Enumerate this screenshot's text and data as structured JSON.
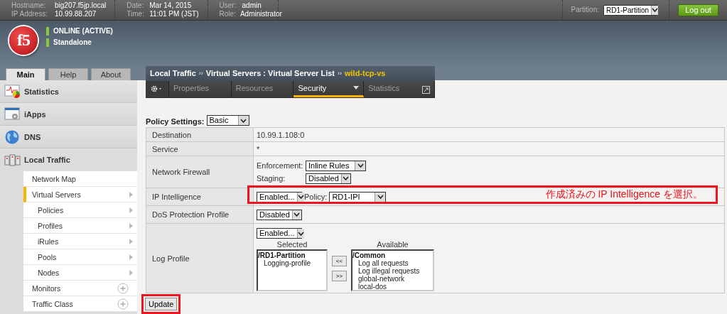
{
  "header": {
    "fields": [
      {
        "label": "Hostname:",
        "value": "big207.f5jp.local"
      },
      {
        "label": "IP Address:",
        "value": "10.99.88.207"
      }
    ],
    "fields2": [
      {
        "label": "Date:",
        "value": "Mar 14, 2015"
      },
      {
        "label": "Time:",
        "value": "11:01 PM (JST)"
      }
    ],
    "fields3": [
      {
        "label": "User:",
        "value": "admin"
      },
      {
        "label": "Role:",
        "value": "Administrator"
      }
    ],
    "partition_label": "Partition:",
    "partition": "RD1-Partition",
    "logout": "Log out"
  },
  "logo": "f5",
  "status": [
    {
      "text": "ONLINE (ACTIVE)",
      "color": "#8dc63f"
    },
    {
      "text": "Standalone",
      "color": "#8dc63f"
    }
  ],
  "nav_tabs": [
    {
      "label": "Main",
      "selected": true
    },
    {
      "label": "Help",
      "selected": false
    },
    {
      "label": "About",
      "selected": false
    }
  ],
  "nav_sections": [
    {
      "label": "Statistics",
      "expanded": false
    },
    {
      "label": "iApps",
      "expanded": false
    },
    {
      "label": "DNS",
      "expanded": false
    },
    {
      "label": "Local Traffic",
      "expanded": true,
      "children": [
        {
          "label": "Network Map",
          "kind": "link",
          "selected": false
        },
        {
          "label": "Virtual Servers",
          "kind": "submenu",
          "selected": true,
          "children": [
            {
              "label": "Policies",
              "kind": "submenu",
              "selected": false
            },
            {
              "label": "Profiles",
              "kind": "submenu",
              "selected": false
            },
            {
              "label": "iRules",
              "kind": "submenu",
              "selected": false
            },
            {
              "label": "Pools",
              "kind": "submenu",
              "selected": false
            },
            {
              "label": "Nodes",
              "kind": "submenu",
              "selected": false
            }
          ]
        },
        {
          "label": "Monitors",
          "kind": "add",
          "selected": false
        },
        {
          "label": "Traffic Class",
          "kind": "add",
          "selected": false
        }
      ]
    }
  ],
  "breadcrumb": [
    {
      "text": "Local Traffic",
      "kind": "crumb"
    },
    {
      "text": "››",
      "kind": "separator"
    },
    {
      "text": "Virtual Servers : Virtual Server List",
      "kind": "crumb"
    },
    {
      "text": "››",
      "kind": "separator"
    },
    {
      "text": "wild-tcp-vs",
      "kind": "current"
    }
  ],
  "tabs": [
    {
      "label": "Properties",
      "kind": "plain",
      "selected": false
    },
    {
      "label": "Resources",
      "kind": "plain",
      "selected": false
    },
    {
      "label": "Security",
      "kind": "menu",
      "selected": true
    },
    {
      "label": "Statistics",
      "kind": "external",
      "selected": false
    }
  ],
  "policy_settings": {
    "label": "Policy Settings:",
    "value": "Basic"
  },
  "rows": [
    {
      "label": "Destination",
      "kind": "text",
      "value": "10.99.1.108:0"
    },
    {
      "label": "Service",
      "kind": "text",
      "value": "*"
    },
    {
      "label": "Network Firewall",
      "kind": "stacked",
      "fields": [
        {
          "label": "Enforcement:",
          "value": "Inline Rules"
        },
        {
          "label": "Staging:",
          "value": "Disabled"
        }
      ]
    },
    {
      "label": "IP Intelligence",
      "kind": "inline",
      "highlighted": true,
      "callout": "作成済みの IP Intelligence を選択。",
      "fields": [
        {
          "value": "Enabled..."
        },
        {
          "label": "Policy:",
          "value": "RD1-IPI"
        }
      ]
    },
    {
      "label": "DoS Protection Profile",
      "kind": "inline",
      "fields": [
        {
          "value": "Disabled"
        }
      ]
    },
    {
      "label": "Log Profile",
      "kind": "log",
      "select": "Enabled...",
      "selected_heading": "Selected",
      "available_heading": "Available",
      "selected_items": [
        {
          "text": "/RD1-Partition",
          "children": [
            {
              "text": "Logging-profile"
            }
          ]
        }
      ],
      "available_items": [
        {
          "text": "/Common",
          "children": [
            {
              "text": "Log all requests"
            },
            {
              "text": "Log illegal requests"
            },
            {
              "text": "global-network"
            },
            {
              "text": "local-dos"
            }
          ]
        }
      ],
      "move_buttons": [
        "<<",
        ">>"
      ]
    }
  ],
  "update_button": {
    "label": "Update",
    "highlighted": true
  }
}
